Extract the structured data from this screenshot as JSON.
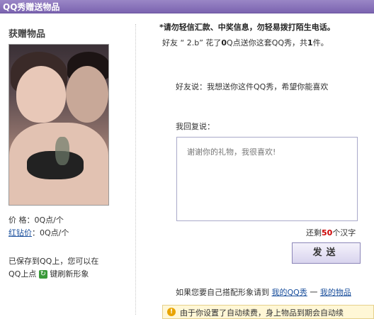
{
  "window": {
    "title": "QQ秀赠送物品"
  },
  "left": {
    "heading": "获赠物品",
    "price_label": "价  格：",
    "price_value": "0Q点/个",
    "red_price_label": "红钻价",
    "red_price_value": "：0Q点/个",
    "saved_text": "已保存到QQ上，您可以在",
    "qq_refresh_prefix": "QQ上点",
    "qq_refresh_suffix": "键刷新形象"
  },
  "main": {
    "warning": "*请勿轻信汇款、中奖信息，勿轻易拨打陌生电话。",
    "info": {
      "prefix": "好友 “ ",
      "friend": "2.b",
      "mid": "” 花了",
      "amount": "0",
      "mid2": "Q点送你这套QQ秀，共",
      "count": "1",
      "suffix": "件。"
    },
    "friend_said": "好友说：我想送你这件QQ秀，希望你能喜欢",
    "reply_label": "我回复说：",
    "reply_placeholder": "谢谢你的礼物，我很喜欢!",
    "counter_prefix": "还剩",
    "counter_value": "50",
    "counter_suffix": "个汉字",
    "send_label": "发送",
    "footer_prefix": "如果您要自己搭配形象请到",
    "link_my_qqshow": "我的QQ秀",
    "link_sep": " 一 ",
    "link_my_items": "我的物品",
    "notice": "由于你设置了自动续费，身上物品到期会自动续"
  }
}
